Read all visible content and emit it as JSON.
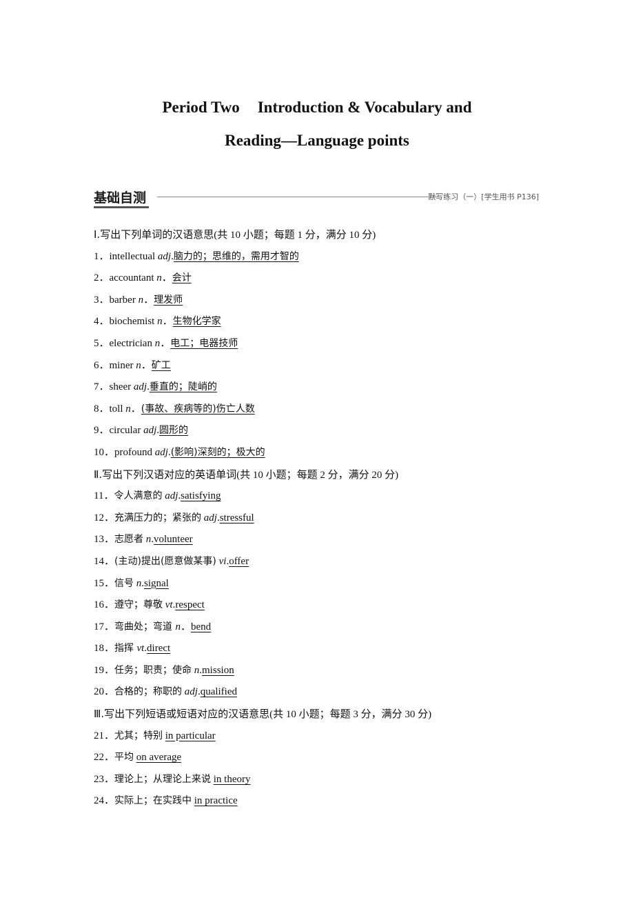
{
  "title": {
    "line1_part1": "Period Two",
    "line1_part2": "Introduction & Vocabulary and",
    "line2": "Reading—Language points"
  },
  "banner": {
    "label": "基础自测",
    "reference": "默写练习（一）[学生用书 P136]"
  },
  "sections": [
    {
      "heading": "Ⅰ.写出下列单词的汉语意思",
      "scoring": "(共 10 小题；每题 1 分，满分 10 分)",
      "items": [
        {
          "num": "1．",
          "word": "intellectual",
          "pos": "adj",
          "sep": ".",
          "answer": "脑力的；思维的，需用才智的"
        },
        {
          "num": "2．",
          "word": "accountant",
          "pos": "n",
          "sep": "．",
          "answer": "会计"
        },
        {
          "num": "3．",
          "word": "barber",
          "pos": "n",
          "sep": "．",
          "answer": "理发师"
        },
        {
          "num": "4．",
          "word": "biochemist",
          "pos": "n",
          "sep": "．",
          "answer": "生物化学家"
        },
        {
          "num": "5．",
          "word": "electrician",
          "pos": "n",
          "sep": "．",
          "answer": "电工；电器技师"
        },
        {
          "num": "6．",
          "word": "miner",
          "pos": "n",
          "sep": "．",
          "answer": "矿工"
        },
        {
          "num": "7．",
          "word": "sheer",
          "pos": "adj",
          "sep": ".",
          "answer": "垂直的；陡峭的"
        },
        {
          "num": "8．",
          "word": "toll",
          "pos": "n",
          "sep": "．",
          "answer": "(事故、疾病等的)伤亡人数"
        },
        {
          "num": "9．",
          "word": "circular",
          "pos": "adj",
          "sep": ".",
          "answer": "圆形的"
        },
        {
          "num": "10．",
          "word": "profound",
          "pos": "adj",
          "sep": ".",
          "answer": "(影响)深刻的；极大的"
        }
      ]
    },
    {
      "heading": "Ⅱ.写出下列汉语对应的英语单词",
      "scoring": "(共 10 小题；每题 2 分，满分 20 分)",
      "items": [
        {
          "num": "11．",
          "word": "令人满意的",
          "pos": "adj",
          "sep": ".",
          "answer": "satisfying"
        },
        {
          "num": "12．",
          "word": "充满压力的；紧张的",
          "pos": "adj",
          "sep": ".",
          "answer": "stressful"
        },
        {
          "num": "13．",
          "word": "志愿者",
          "pos": "n",
          "sep": ".",
          "answer": "volunteer"
        },
        {
          "num": "14．",
          "word": "(主动)提出(愿意做某事)",
          "pos": "vi",
          "sep": ".",
          "answer": "offer"
        },
        {
          "num": "15．",
          "word": "信号",
          "pos": "n",
          "sep": ".",
          "answer": "signal"
        },
        {
          "num": "16．",
          "word": "遵守；尊敬",
          "pos": "vt",
          "sep": ".",
          "answer": "respect"
        },
        {
          "num": "17．",
          "word": "弯曲处；弯道 ",
          "pos": "n",
          "sep": "．",
          "answer": "bend"
        },
        {
          "num": "18．",
          "word": "指挥 ",
          "pos": "vt",
          "sep": ".",
          "answer": "direct"
        },
        {
          "num": "19．",
          "word": "任务；职责；使命",
          "pos": "n",
          "sep": ".",
          "answer": "mission"
        },
        {
          "num": "20．",
          "word": "合格的；称职的",
          "pos": "adj",
          "sep": ".",
          "answer": "qualified"
        }
      ]
    },
    {
      "heading": "Ⅲ.写出下列短语或短语对应的汉语意思",
      "scoring": "(共 10 小题；每题 3 分，满分 30 分)",
      "items": [
        {
          "num": "21．",
          "word": "尤其；特别",
          "answer": "in particular"
        },
        {
          "num": "22．",
          "word": "平均",
          "answer": "on average"
        },
        {
          "num": "23．",
          "word": "理论上；从理论上来说",
          "answer": "in theory"
        },
        {
          "num": "24．",
          "word": "实际上；在实践中",
          "answer": "in practice"
        }
      ]
    }
  ]
}
